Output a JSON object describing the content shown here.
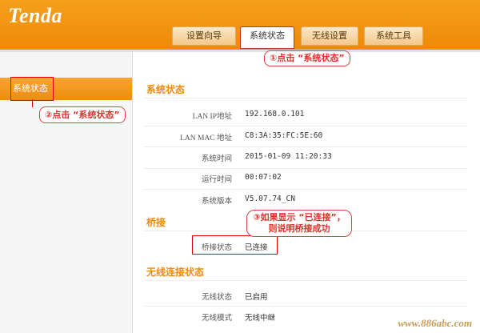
{
  "brand": {
    "logo": "Tenda"
  },
  "nav": {
    "tabs": [
      {
        "label": "设置向导"
      },
      {
        "label": "系统状态"
      },
      {
        "label": "无线设置"
      },
      {
        "label": "系统工具"
      }
    ]
  },
  "sidebar": {
    "items": [
      {
        "label": "系统状态"
      }
    ]
  },
  "annotations": {
    "callout1": "①点击 “系统状态”",
    "callout2": "②点击 “系统状态”",
    "callout3": "③如果显示 “已连接”，则说明桥接成功"
  },
  "main": {
    "section_status": "系统状态",
    "status_rows": [
      {
        "label": "LAN IP地址",
        "value": "192.168.0.101"
      },
      {
        "label": "LAN MAC 地址",
        "value": "C8:3A:35:FC:5E:60"
      },
      {
        "label": "系统时间",
        "value": "2015-01-09 11:20:33"
      },
      {
        "label": "运行时间",
        "value": "00:07:02"
      },
      {
        "label": "系统版本",
        "value": "V5.07.74_CN"
      }
    ],
    "section_bridge": "桥接",
    "bridge_rows": [
      {
        "label": "桥接状态",
        "value": "已连接"
      }
    ],
    "section_wireless": "无线连接状态",
    "wireless_rows": [
      {
        "label": "无线状态",
        "value": "已启用"
      },
      {
        "label": "无线模式",
        "value": "无线中继"
      }
    ]
  },
  "watermark": "www.886abc.com",
  "colors": {
    "brand_orange": "#ef8a08",
    "annotation_red": "#e0302a"
  }
}
